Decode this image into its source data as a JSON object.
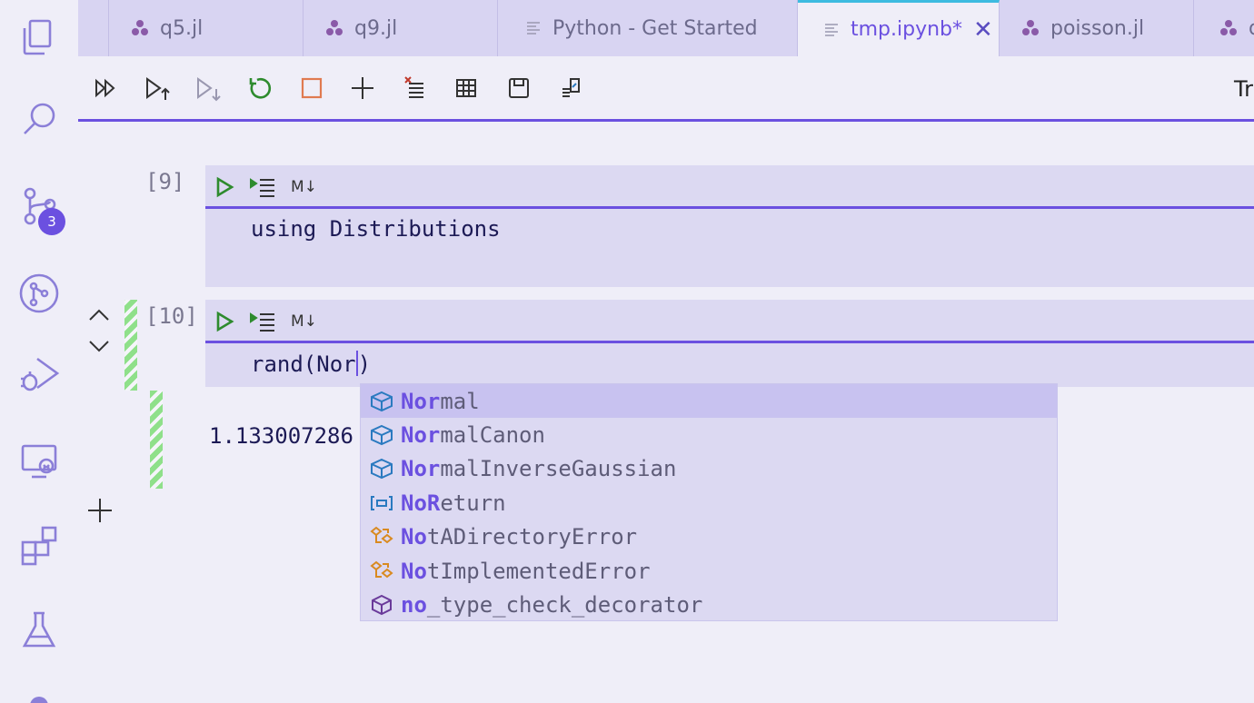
{
  "activity": {
    "scm_badge": "3"
  },
  "tabs": [
    {
      "label": "q5.jl",
      "icon": "julia-icon"
    },
    {
      "label": "q9.jl",
      "icon": "julia-icon"
    },
    {
      "label": "Python - Get Started",
      "icon": "file-lines-icon"
    },
    {
      "label": "tmp.ipynb*",
      "icon": "file-lines-icon",
      "active": true
    },
    {
      "label": "poisson.jl",
      "icon": "julia-icon"
    },
    {
      "label": "q",
      "icon": "julia-icon"
    }
  ],
  "toolbar": {
    "trailing_label": "Tr"
  },
  "cells": [
    {
      "prompt": "[9]",
      "code": "using Distributions",
      "md_toggle": "M↓"
    },
    {
      "prompt": "[10]",
      "code": "rand(Nor",
      "code_after": ")",
      "md_toggle": "M↓"
    }
  ],
  "output": {
    "text": "1.133007286"
  },
  "suggestions": [
    {
      "match": "Nor",
      "rest": "mal",
      "kind": "struct-icon",
      "selected": true
    },
    {
      "match": "Nor",
      "rest": "malCanon",
      "kind": "struct-icon"
    },
    {
      "match": "Nor",
      "rest": "malInverseGaussian",
      "kind": "struct-icon"
    },
    {
      "match": "NoR",
      "rest": "eturn",
      "kind": "enum-icon"
    },
    {
      "match": "No",
      "rest": "tADirectoryError",
      "kind": "class-icon"
    },
    {
      "match": "No",
      "rest": "tImplementedError",
      "kind": "class-icon"
    },
    {
      "match": "no",
      "rest": "_type_check_decorator",
      "kind": "module-icon"
    }
  ],
  "colors": {
    "accent": "#6b50e0",
    "run_green": "#2e8b2e",
    "stop_orange": "#e07a50",
    "tab_active_border": "#3dbbe0"
  }
}
